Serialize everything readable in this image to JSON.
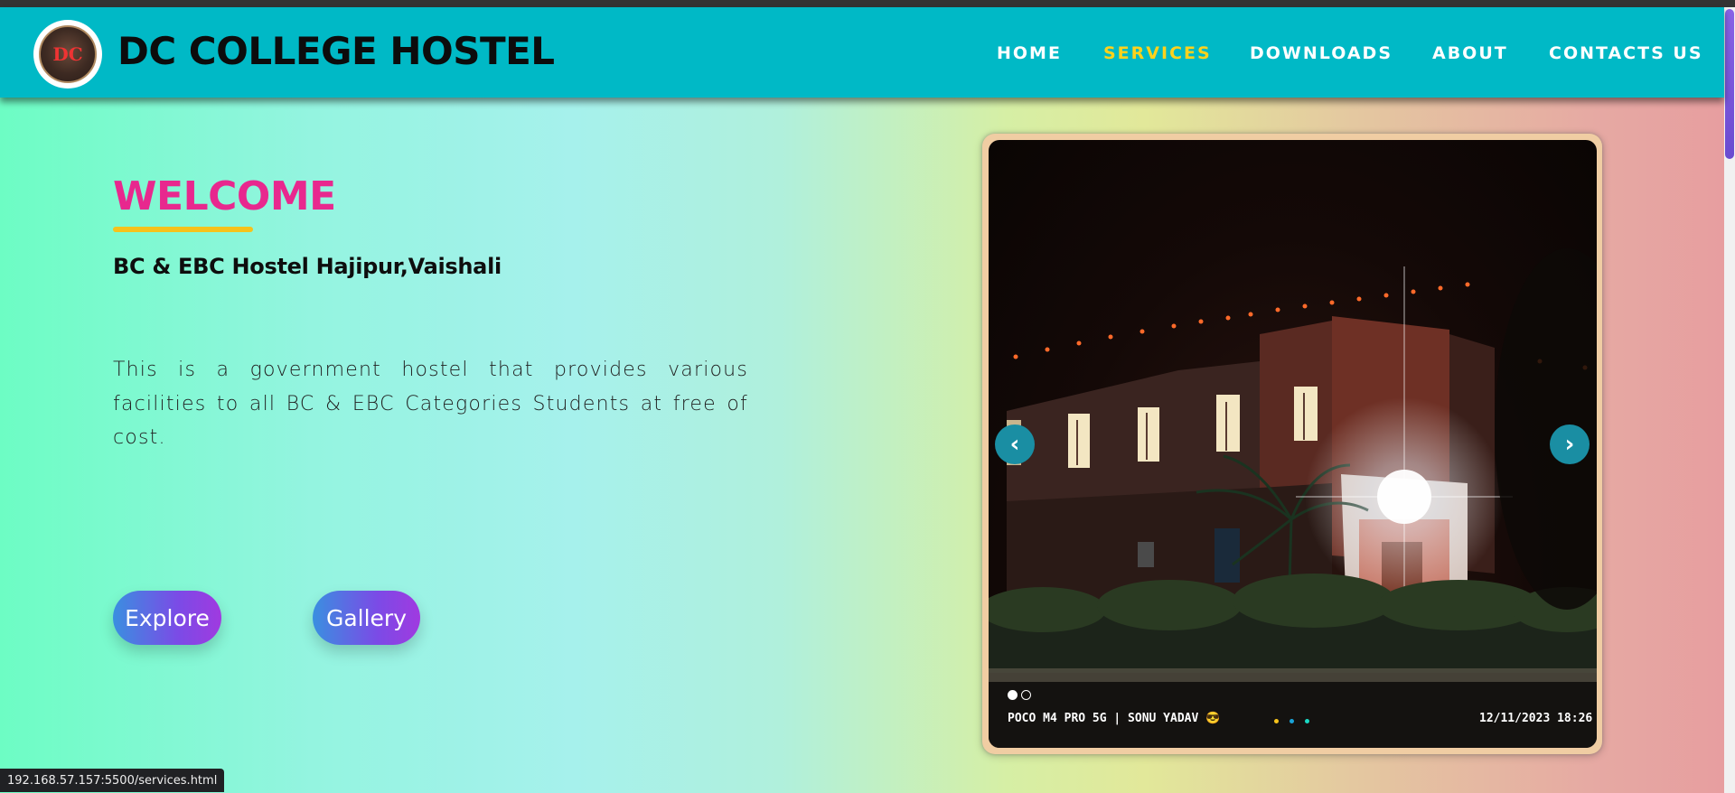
{
  "header": {
    "logo_text": "DC",
    "site_title": "DC COLLEGE HOSTEL",
    "nav": [
      {
        "label": "HOME",
        "active": false
      },
      {
        "label": "SERVICES",
        "active": true
      },
      {
        "label": "DOWNLOADS",
        "active": false
      },
      {
        "label": "ABOUT",
        "active": false
      },
      {
        "label": "CONTACTS US",
        "active": false
      }
    ]
  },
  "hero": {
    "welcome": "WELCOME",
    "subtitle": "BC & EBC Hostel Hajipur,Vaishali",
    "description": "This is a government hostel that provides various facilities to all BC & EBC Categories Students at free of cost.",
    "buttons": {
      "explore": "Explore",
      "gallery": "Gallery"
    }
  },
  "carousel": {
    "prev_icon": "‹",
    "next_icon": "›",
    "photo_tag": "POCO M4 PRO 5G | SONU YADAV 😎",
    "photo_date": "12/11/2023   18:26",
    "slide_count": 2,
    "active_slide": 1
  },
  "status_bar": {
    "url": "192.168.57.157:5500/services.html"
  },
  "colors": {
    "header_bg": "#00b9c6",
    "nav_active": "#ffd21c",
    "welcome": "#e8288e",
    "accent_bar": "#f6c21b"
  }
}
